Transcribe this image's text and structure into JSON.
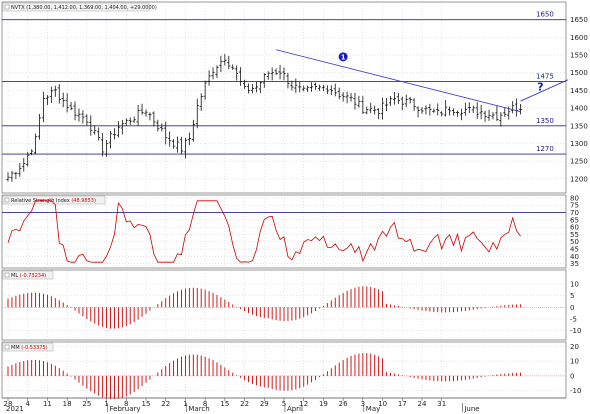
{
  "chart_data": [
    {
      "type": "ohlc",
      "legend": {
        "name": "NVTX",
        "values": "(1,380.00, 1,412.00, 1,369.00, 1,404.00, +29.0000)"
      },
      "ylim": [
        1160,
        1700
      ],
      "yticks": [
        1200,
        1250,
        1300,
        1350,
        1400,
        1450,
        1500,
        1550,
        1600,
        1650
      ],
      "horizontal_lines": [
        {
          "value": 1650,
          "label": "1650"
        },
        {
          "value": 1475,
          "label": "1475"
        },
        {
          "value": 1350,
          "label": "1350"
        },
        {
          "value": 1270,
          "label": "1270"
        }
      ],
      "trendline": {
        "from": {
          "bar": 68,
          "value": 1565
        },
        "to": {
          "bar": 130,
          "value": 1390
        }
      },
      "breakout_line": {
        "from": {
          "bar": 130,
          "value": 1420
        },
        "to": {
          "bar": 142,
          "value": 1480
        }
      },
      "annotations": [
        {
          "text": "1",
          "bar": 85,
          "value": 1545,
          "style": "circle"
        },
        {
          "text": "?",
          "bar": 135,
          "value": 1450,
          "style": "text"
        }
      ],
      "grid": true
    },
    {
      "type": "line",
      "legend": {
        "name": "Relative Strength Index",
        "values": "(48.9853)"
      },
      "ylim": [
        32,
        82
      ],
      "yticks": [
        35,
        40,
        45,
        50,
        55,
        60,
        65,
        70,
        75,
        80
      ],
      "horizontal_lines": [
        {
          "value": 70
        },
        {
          "value": 30
        }
      ],
      "grid": true
    },
    {
      "type": "histogram",
      "legend": {
        "name": "ML",
        "values": "(-0.73234)"
      },
      "ylim": [
        -14,
        16
      ],
      "yticks": [
        -10,
        -5,
        0,
        5,
        10
      ],
      "grid": true
    },
    {
      "type": "histogram",
      "legend": {
        "name": "MM",
        "values": "(-0.53375)"
      },
      "ylim": [
        -15,
        23
      ],
      "yticks": [
        -10,
        0,
        10,
        20
      ],
      "grid": true
    }
  ],
  "x_axis": {
    "bars": 140,
    "year_label": "2021",
    "labels": [
      {
        "text": "28",
        "bar": 0
      },
      {
        "text": "4",
        "bar": 5
      },
      {
        "text": "11",
        "bar": 10
      },
      {
        "text": "18",
        "bar": 15
      },
      {
        "text": "25",
        "bar": 20
      },
      {
        "text": "1",
        "bar": 25
      },
      {
        "text": "February",
        "bar": 26,
        "month": true
      },
      {
        "text": "8",
        "bar": 30
      },
      {
        "text": "15",
        "bar": 35
      },
      {
        "text": "22",
        "bar": 40
      },
      {
        "text": "1",
        "bar": 45
      },
      {
        "text": "March",
        "bar": 46,
        "month": true
      },
      {
        "text": "8",
        "bar": 50
      },
      {
        "text": "15",
        "bar": 55
      },
      {
        "text": "22",
        "bar": 60
      },
      {
        "text": "29",
        "bar": 65
      },
      {
        "text": "5",
        "bar": 70
      },
      {
        "text": "April",
        "bar": 71,
        "month": true
      },
      {
        "text": "12",
        "bar": 75
      },
      {
        "text": "19",
        "bar": 80
      },
      {
        "text": "26",
        "bar": 85
      },
      {
        "text": "3",
        "bar": 90
      },
      {
        "text": "May",
        "bar": 91,
        "month": true
      },
      {
        "text": "10",
        "bar": 95
      },
      {
        "text": "17",
        "bar": 100
      },
      {
        "text": "24",
        "bar": 105
      },
      {
        "text": "31",
        "bar": 110
      },
      {
        "text": "June",
        "bar": 116,
        "month": true
      }
    ]
  },
  "colors": {
    "background": "#ffffff",
    "grid": "#c8c8c8",
    "level_line": "#2b2b8f",
    "trendline": "#3a3ad0",
    "indicator": "#cc0000",
    "price_bar": "#111111"
  }
}
